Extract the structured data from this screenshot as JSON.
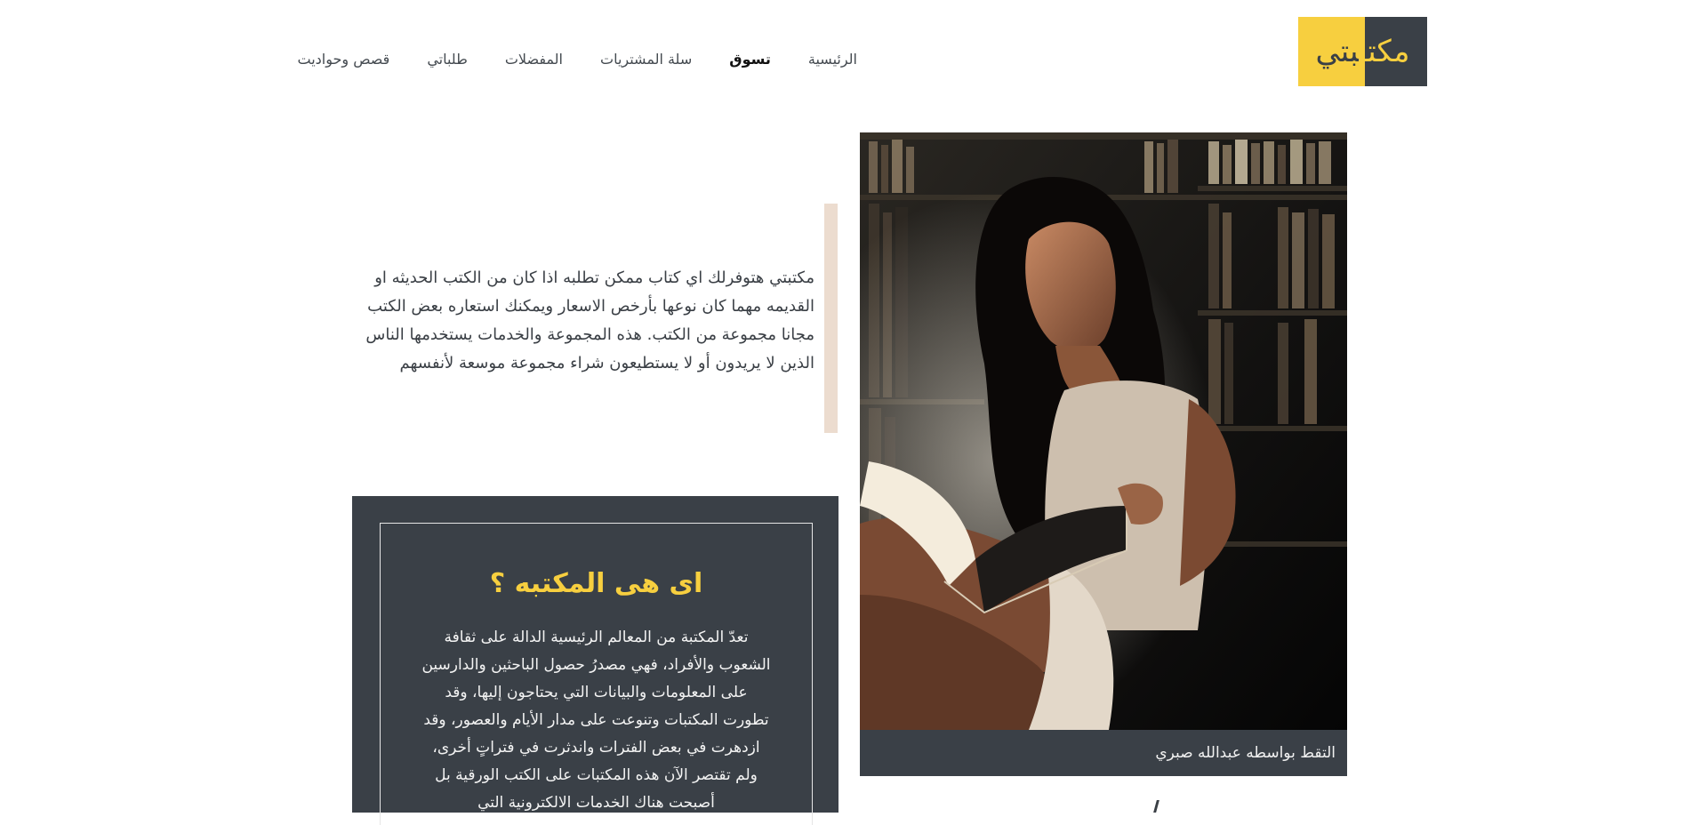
{
  "logo": {
    "text_part_yellow": "بتي",
    "text_part_dark": "مكتـ",
    "full": "مكتـــبتي"
  },
  "nav": {
    "items": [
      {
        "label": "الرئيسية",
        "active": false
      },
      {
        "label": "تسوق",
        "active": true
      },
      {
        "label": "سلة المشتريات",
        "active": false
      },
      {
        "label": "المفضلات",
        "active": false
      },
      {
        "label": "طلباتي",
        "active": false
      },
      {
        "label": "قصص وحواديت",
        "active": false
      }
    ]
  },
  "intro": {
    "text": "مكتبتي هتوفرلك اي كتاب ممكن تطلبه اذا كان من الكتب الحديثه او القديمه مهما كان نوعها بأرخص الاسعار ويمكنك استعاره بعض الكتب مجانا مجموعة من الكتب. هذه المجموعة والخدمات يستخدمها الناس الذين لا يريدون أو لا يستطيعون شراء مجموعة موسعة لأنفسهم"
  },
  "photo": {
    "caption": "التقط بواسطه عبدالله صبري"
  },
  "card": {
    "title": "اى هى المكتبه ؟",
    "text": "تعدّ المكتبة من المعالم الرئيسية الدالة على ثقافة الشعوب والأفراد، فهي مصدرُ حصول الباحثين والدارسين على المعلومات والبيانات التي يحتاجون إليها، وقد تطورت المكتبات وتنوعت على مدار الأيام والعصور، وقد ازدهرت في بعض الفترات واندثرت في فتراتٍ أخرى، ولم تقتصر الآن هذه المكتبات على الكتب الورقية بل أصبحت هناك الخدمات الالكترونية التي"
  },
  "colors": {
    "brand_yellow": "#f7cf3f",
    "brand_dark": "#3a4047",
    "accent_beige": "#ecdccf"
  }
}
